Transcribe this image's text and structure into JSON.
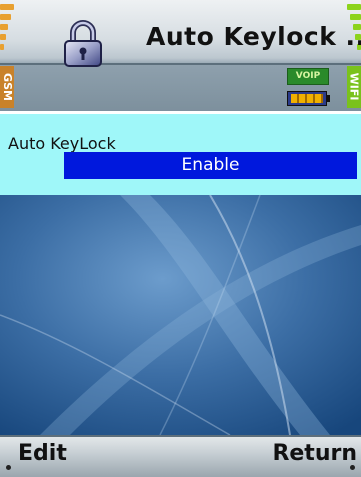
{
  "header": {
    "title": "Auto Keylock ...",
    "left_network_label": "GSM",
    "right_network_label": "WIFI",
    "voip_badge": "VOIP",
    "icons": [
      "lock-icon",
      "battery-icon",
      "signal-bars-icon"
    ],
    "colors": {
      "gsm": "#c9822a",
      "wifi": "#7ac21c"
    }
  },
  "form": {
    "label": "Auto KeyLock",
    "selected_value": "Enable",
    "colors": {
      "panel": "#9ff7f9",
      "selected": "#0018dd"
    }
  },
  "softkeys": {
    "left": "Edit",
    "right": "Return"
  }
}
